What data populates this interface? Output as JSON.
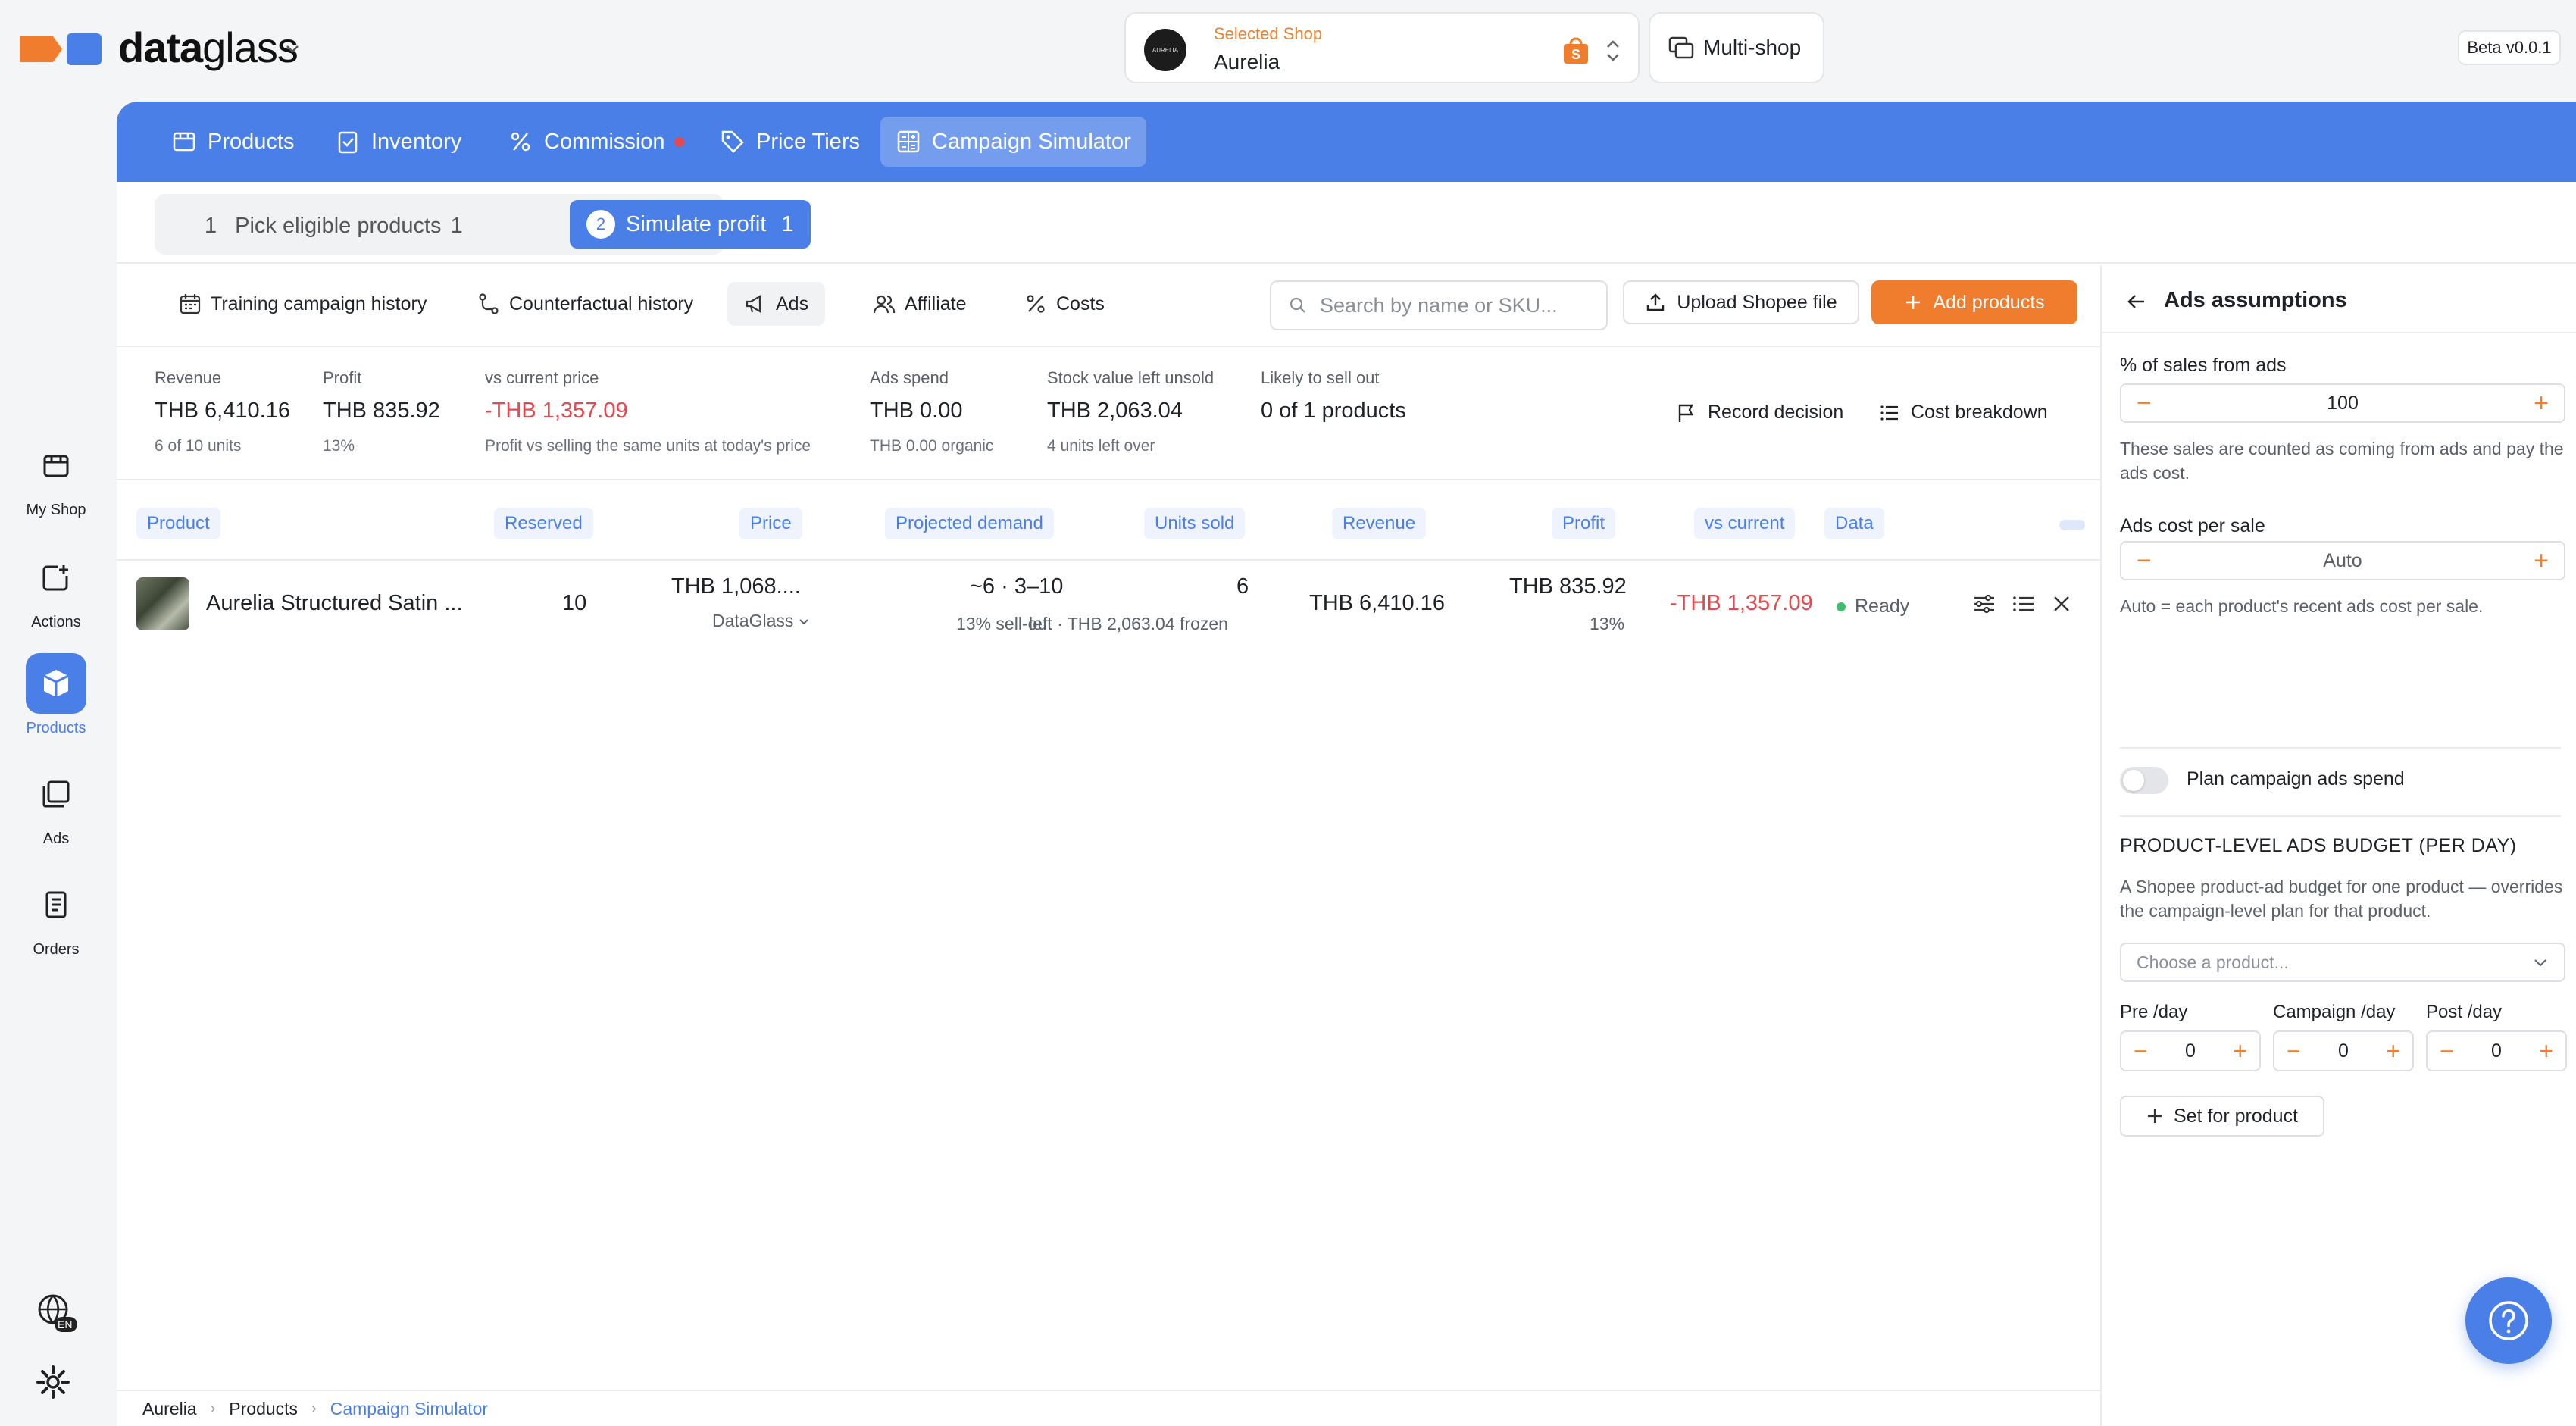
{
  "app": {
    "name_bold": "data",
    "name_light": "glass",
    "version": "Beta v0.0.1"
  },
  "shop": {
    "label": "Selected Shop",
    "name": "Aurelia",
    "avatar_text": "AURELIA"
  },
  "multishop": {
    "label": "Multi-shop"
  },
  "sidebar": {
    "items": [
      {
        "label": "My Shop",
        "icon": "store-icon"
      },
      {
        "label": "Actions",
        "icon": "add-action-icon"
      },
      {
        "label": "Products",
        "icon": "box-icon",
        "active": true
      },
      {
        "label": "Ads",
        "icon": "ads-icon"
      },
      {
        "label": "Orders",
        "icon": "orders-icon"
      }
    ],
    "language_badge": "EN"
  },
  "tabs": [
    {
      "label": "Products"
    },
    {
      "label": "Inventory"
    },
    {
      "label": "Commission"
    },
    {
      "label": "Price Tiers"
    },
    {
      "label": "Campaign Simulator",
      "active": true
    }
  ],
  "steps": {
    "step1": {
      "num": "1",
      "label": "Pick eligible products",
      "count": "1"
    },
    "step2": {
      "num": "2",
      "label": "Simulate profit",
      "count": "1"
    }
  },
  "subtabs": [
    {
      "label": "Training campaign history"
    },
    {
      "label": "Counterfactual history"
    },
    {
      "label": "Ads",
      "active": true
    },
    {
      "label": "Affiliate"
    },
    {
      "label": "Costs"
    }
  ],
  "search": {
    "placeholder": "Search by name or SKU..."
  },
  "buttons": {
    "upload": "Upload Shopee file",
    "add": "Add products",
    "record": "Record decision",
    "cost": "Cost breakdown",
    "set_product": "Set for product"
  },
  "stats": {
    "revenue": {
      "label": "Revenue",
      "value": "THB 6,410.16",
      "sub": "6 of 10 units"
    },
    "profit": {
      "label": "Profit",
      "value": "THB 835.92",
      "sub": "13%"
    },
    "vs_current": {
      "label": "vs current price",
      "value": "-THB 1,357.09",
      "sub": "Profit vs selling the same units at today's price"
    },
    "ads_spend": {
      "label": "Ads spend",
      "value": "THB 0.00",
      "sub": "THB 0.00 organic"
    },
    "stock_left": {
      "label": "Stock value left unsold",
      "value": "THB 2,063.04",
      "sub": "4 units left over"
    },
    "sell_out": {
      "label": "Likely to sell out",
      "value": "0 of 1 products"
    }
  },
  "table": {
    "headers": [
      "Product",
      "Reserved",
      "Price",
      "Projected demand",
      "Units sold",
      "Revenue",
      "Profit",
      "vs current",
      "Data"
    ],
    "rows": [
      {
        "product": "Aurelia Structured Satin ...",
        "reserved": "10",
        "price": "THB 1,068....",
        "price_source": "DataGlass",
        "demand": "~6 · 3–10",
        "demand_sub": "13% sell-out",
        "units_sold": "6",
        "units_sub": "left · THB 2,063.04 frozen",
        "revenue": "THB 6,410.16",
        "profit": "THB 835.92",
        "profit_sub": "13%",
        "vs_current": "-THB 1,357.09",
        "status": "Ready"
      }
    ]
  },
  "breadcrumb": [
    "Aurelia",
    "Products",
    "Campaign Simulator"
  ],
  "panel": {
    "title": "Ads assumptions",
    "sales_from_ads": {
      "label": "% of sales from ads",
      "value": "100",
      "desc": "These sales are counted as coming from ads and pay the ads cost."
    },
    "cost_per_sale": {
      "label": "Ads cost per sale",
      "value": "Auto",
      "desc": "Auto = each product's recent ads cost per sale."
    },
    "plan_toggle": {
      "label": "Plan campaign ads spend",
      "on": false
    },
    "budget": {
      "heading": "PRODUCT-LEVEL ADS BUDGET (PER DAY)",
      "desc": "A Shopee product-ad budget for one product — overrides the campaign-level plan for that product.",
      "select_placeholder": "Choose a product...",
      "pre": {
        "label": "Pre /day",
        "value": "0"
      },
      "campaign": {
        "label": "Campaign /day",
        "value": "0"
      },
      "post": {
        "label": "Post /day",
        "value": "0"
      }
    }
  },
  "colors": {
    "accent": "#4a7fe8",
    "orange": "#ef7d2d",
    "negative": "#e5484d",
    "ready": "#3fbf6b"
  }
}
